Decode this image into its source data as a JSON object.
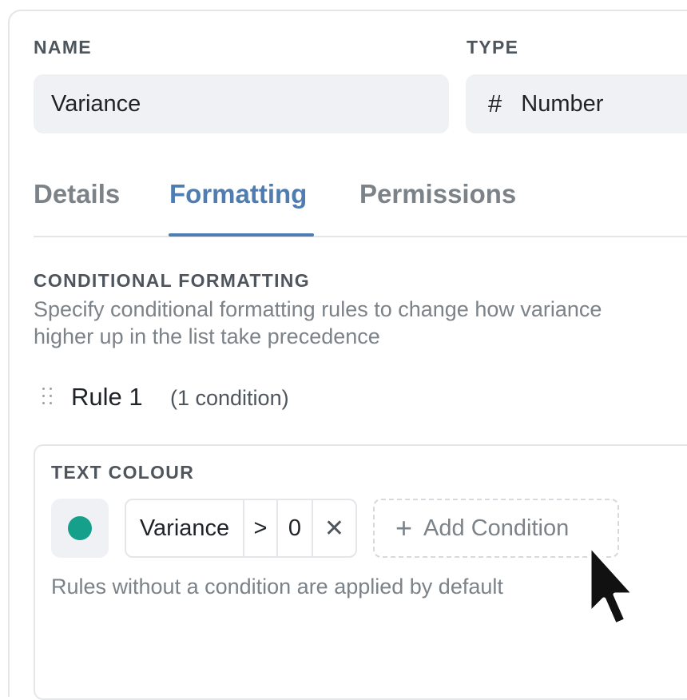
{
  "form": {
    "name_label": "NAME",
    "name_value": "Variance",
    "type_label": "TYPE",
    "type_icon": "hash-icon",
    "type_value": "Number"
  },
  "tabs": [
    {
      "label": "Details",
      "active": false
    },
    {
      "label": "Formatting",
      "active": true
    },
    {
      "label": "Permissions",
      "active": false
    }
  ],
  "conditional_formatting": {
    "heading": "CONDITIONAL FORMATTING",
    "description_line1": "Specify conditional formatting rules to change how variance",
    "description_line2": "higher up in the list take precedence"
  },
  "rule": {
    "title": "Rule 1",
    "count": "(1 condition)",
    "section_label": "TEXT COLOUR",
    "colour": "#14a08a",
    "condition": {
      "field": "Variance",
      "operator": ">",
      "value": "0",
      "remove_glyph": "✕"
    },
    "add_condition_label": "Add Condition",
    "hint": "Rules without a condition are applied by default"
  },
  "colors": {
    "accent": "#4f7cb1",
    "swatch": "#14a08a"
  }
}
